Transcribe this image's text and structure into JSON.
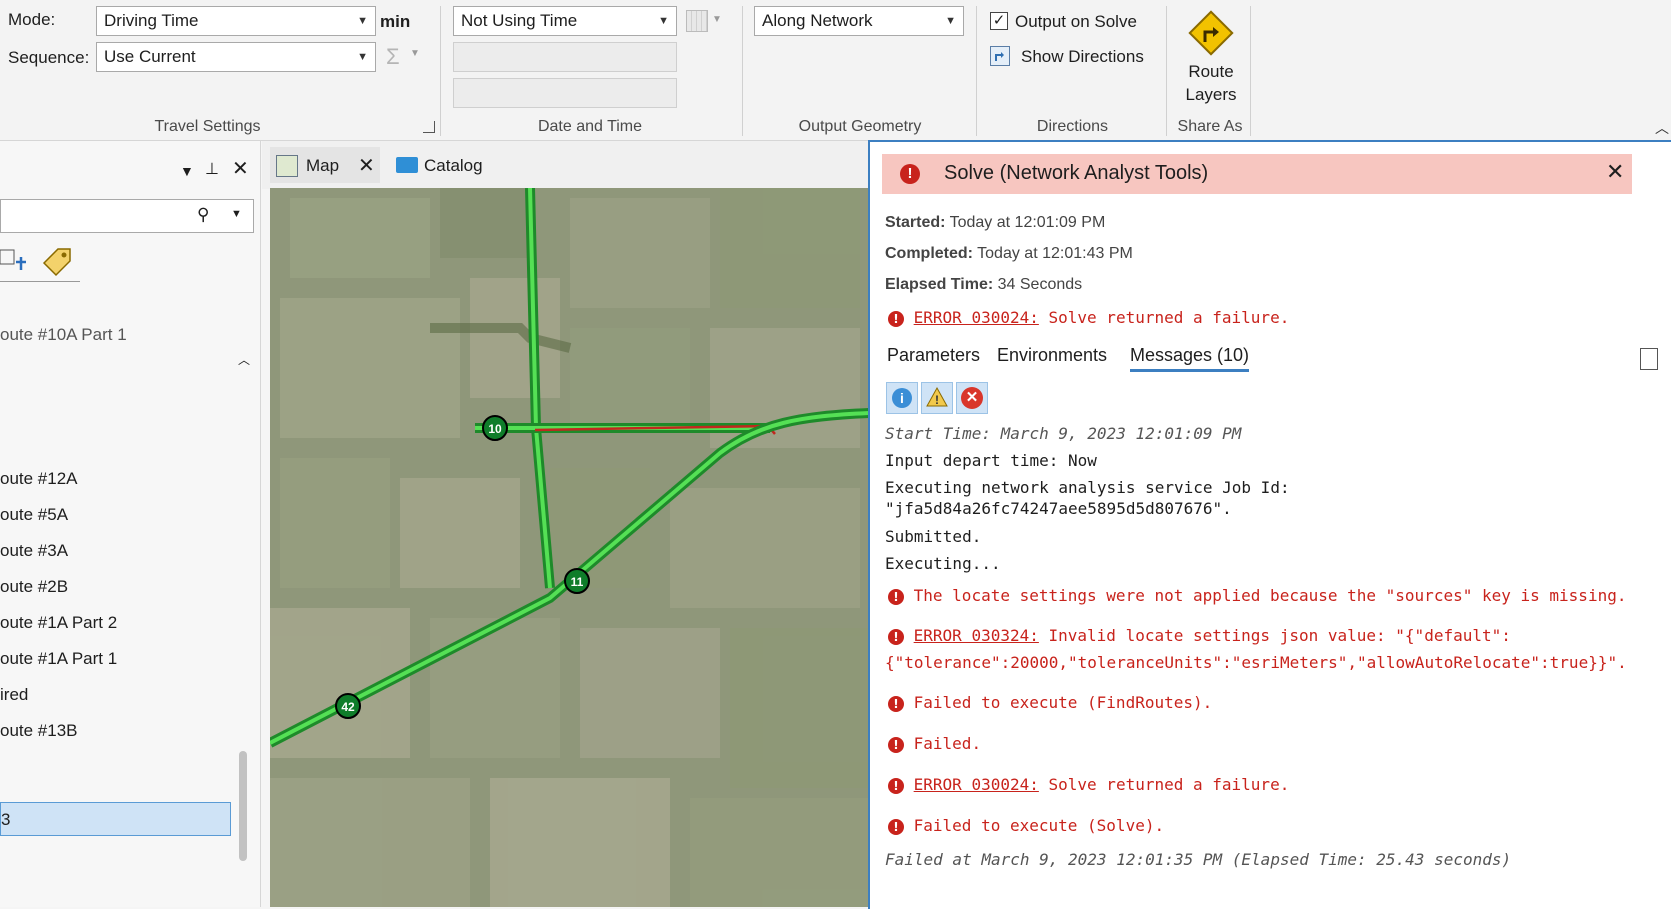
{
  "ribbon": {
    "mode_label": "Mode:",
    "mode_value": "Driving Time",
    "mode_unit": "min",
    "sequence_label": "Sequence:",
    "sequence_value": "Use Current",
    "sum_icon": "Σ",
    "travel_settings_label": "Travel Settings",
    "time_value": "Not Using Time",
    "date_time_label": "Date and Time",
    "geometry_value": "Along Network",
    "output_geometry_label": "Output Geometry",
    "output_on_solve_label": "Output on Solve",
    "output_on_solve_checked": true,
    "show_directions_label": "Show Directions",
    "directions_label": "Directions",
    "route_layers_line1": "Route",
    "route_layers_line2": "Layers",
    "share_as_label": "Share As"
  },
  "left_pane": {
    "items": [
      "oute #10A Part 1",
      "oute #12A",
      "oute #5A",
      "oute #3A",
      "oute #2B",
      "oute #1A Part 2",
      "oute #1A Part 1",
      "ired",
      "oute #13B",
      "3"
    ]
  },
  "tabs": {
    "map_label": "Map",
    "catalog_label": "Catalog"
  },
  "map": {
    "stops": [
      "10",
      "11",
      "42"
    ]
  },
  "panel": {
    "title": "Solve (Network Analyst Tools)",
    "started_label": "Started:",
    "started_value": "Today at 12:01:09 PM",
    "completed_label": "Completed:",
    "completed_value": "Today at 12:01:43 PM",
    "elapsed_label": "Elapsed Time:",
    "elapsed_value": "34 Seconds",
    "summary_error_code": "ERROR 030024:",
    "summary_error_text": " Solve returned a failure.",
    "tabs": [
      "Parameters",
      "Environments",
      "Messages (10)"
    ],
    "messages": {
      "start_time": "Start Time: March 9, 2023 12:01:09 PM",
      "depart": "Input depart time: Now",
      "executing_line1": "Executing network analysis service Job Id:",
      "executing_line2": "\"jfa5d84a26fc74247aee5895d5d807676\".",
      "submitted": "Submitted.",
      "executing": "Executing...",
      "err1": "The locate settings were not applied because the \"sources\" key is missing.",
      "err2_code": "ERROR 030324:",
      "err2_text": " Invalid locate settings json value: \"{\"default\":",
      "err2_line2": "{\"tolerance\":20000,\"toleranceUnits\":\"esriMeters\",\"allowAutoRelocate\":true}}\".",
      "err3": "Failed to execute (FindRoutes).",
      "err4": "Failed.",
      "err5_code": "ERROR 030024:",
      "err5_text": " Solve returned a failure.",
      "err6": "Failed to execute (Solve).",
      "failed_at": "Failed at March 9, 2023 12:01:35 PM (Elapsed Time: 25.43 seconds)"
    }
  },
  "colors": {
    "error": "#c8231c",
    "header_bg": "#f7c6c0",
    "accent": "#3c7fc1",
    "route_green": "#33cc33"
  }
}
